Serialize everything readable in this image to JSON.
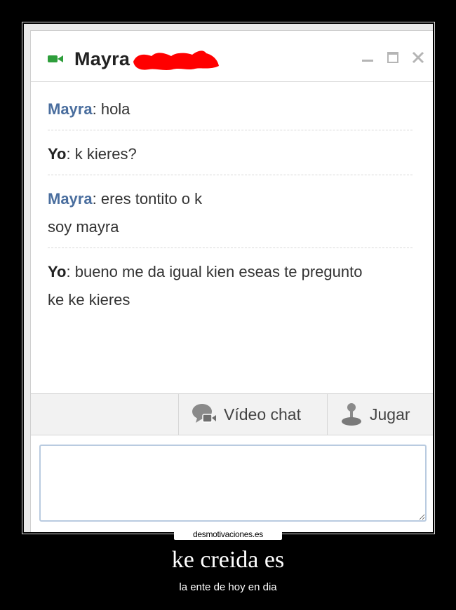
{
  "window": {
    "contact_name": "Mayra",
    "icons": {
      "status": "video-camera-icon",
      "minimize": "minimize-icon",
      "maximize": "maximize-icon",
      "close": "close-icon"
    }
  },
  "messages": [
    {
      "sender": "Mayra",
      "lines": [
        "hola"
      ]
    },
    {
      "sender": "Yo",
      "lines": [
        "k kieres?"
      ]
    },
    {
      "sender": "Mayra",
      "lines": [
        "eres tontito o k",
        "soy mayra"
      ]
    },
    {
      "sender": "Yo",
      "lines": [
        "bueno me da igual kien eseas te pregunto",
        "ke ke kieres"
      ]
    }
  ],
  "toolbar": {
    "video_chat_label": "Vídeo chat",
    "play_label": "Jugar"
  },
  "input": {
    "value": ""
  },
  "poster": {
    "watermark": "desmotivaciones.es",
    "title": "ke creida es",
    "subtitle": "la ente de hoy en dia"
  },
  "colors": {
    "contact_name": "#4a6e9e",
    "redaction": "#ff0000",
    "status_icon": "#2e9e3b"
  }
}
